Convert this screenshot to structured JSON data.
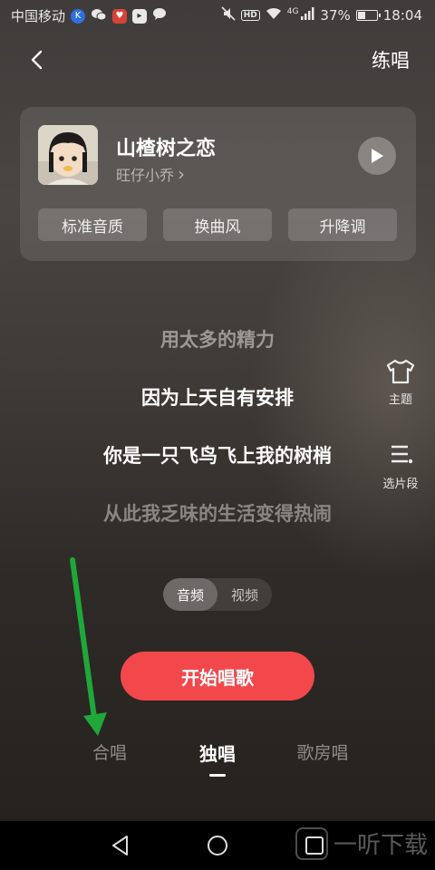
{
  "status_bar": {
    "carrier": "中国移动",
    "hd": "HD",
    "signal_label": "4G",
    "battery": "37%",
    "battery_level": 0.37,
    "time": "18:04"
  },
  "header": {
    "action_label": "练唱"
  },
  "song": {
    "title": "山楂树之恋",
    "artist": "旺仔小乔",
    "artist_chevron": "›",
    "options": [
      "标准音质",
      "换曲风",
      "升降调"
    ]
  },
  "lyrics": [
    "用太多的精力",
    "因为上天自有安排",
    "你是一只飞鸟飞上我的树梢",
    "从此我乏味的生活变得热闹"
  ],
  "side_tools": {
    "theme_label": "主题",
    "segment_label": "选片段"
  },
  "media_toggle": {
    "audio": "音频",
    "video": "视频",
    "selected": "audio"
  },
  "start_button": "开始唱歌",
  "mode_tabs": {
    "chorus": "合唱",
    "solo": "独唱",
    "ktv": "歌房唱",
    "selected": "solo"
  },
  "watermark": "一听下载",
  "colors": {
    "accent": "#f2484c",
    "annotation_arrow": "#1fa839"
  }
}
